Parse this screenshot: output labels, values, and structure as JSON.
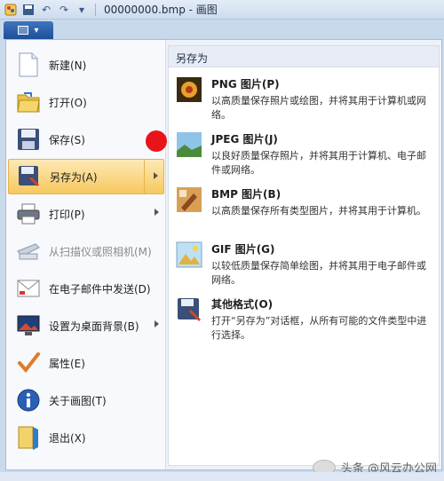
{
  "window": {
    "title": "00000000.bmp - 画图"
  },
  "menu": {
    "items": [
      {
        "label": "新建(N)",
        "icon": "new-file-icon"
      },
      {
        "label": "打开(O)",
        "icon": "open-folder-icon"
      },
      {
        "label": "保存(S)",
        "icon": "save-floppy-icon"
      },
      {
        "label": "另存为(A)",
        "icon": "save-as-icon",
        "active": true,
        "submenu": true
      },
      {
        "label": "打印(P)",
        "icon": "printer-icon",
        "submenu": true
      },
      {
        "label": "从扫描仪或照相机(M)",
        "icon": "scanner-icon",
        "disabled": true
      },
      {
        "label": "在电子邮件中发送(D)",
        "icon": "email-icon"
      },
      {
        "label": "设置为桌面背景(B)",
        "icon": "desktop-background-icon",
        "submenu": true
      },
      {
        "label": "属性(E)",
        "icon": "checkmark-icon"
      },
      {
        "label": "关于画图(T)",
        "icon": "info-icon"
      },
      {
        "label": "退出(X)",
        "icon": "exit-icon"
      }
    ]
  },
  "saveas": {
    "header": "另存为",
    "options": [
      {
        "title": "PNG 图片(P)",
        "desc": "以高质量保存照片或绘图，并将其用于计算机或网络。",
        "icon": "png-image-icon"
      },
      {
        "title": "JPEG 图片(J)",
        "desc": "以良好质量保存照片，并将其用于计算机、电子邮件或网络。",
        "icon": "jpeg-image-icon"
      },
      {
        "title": "BMP 图片(B)",
        "desc": "以高质量保存所有类型图片，并将其用于计算机。",
        "icon": "bmp-image-icon"
      },
      {
        "title": "GIF 图片(G)",
        "desc": "以较低质量保存简单绘图，并将其用于电子邮件或网络。",
        "icon": "gif-image-icon"
      },
      {
        "title": "其他格式(O)",
        "desc": "打开“另存为”对话框，从所有可能的文件类型中进行选择。",
        "icon": "other-formats-icon"
      }
    ]
  },
  "watermark": {
    "text": "头条 @风云办公网"
  },
  "colors": {
    "highlight": "#f7c85f",
    "marker": "#e8141a"
  }
}
